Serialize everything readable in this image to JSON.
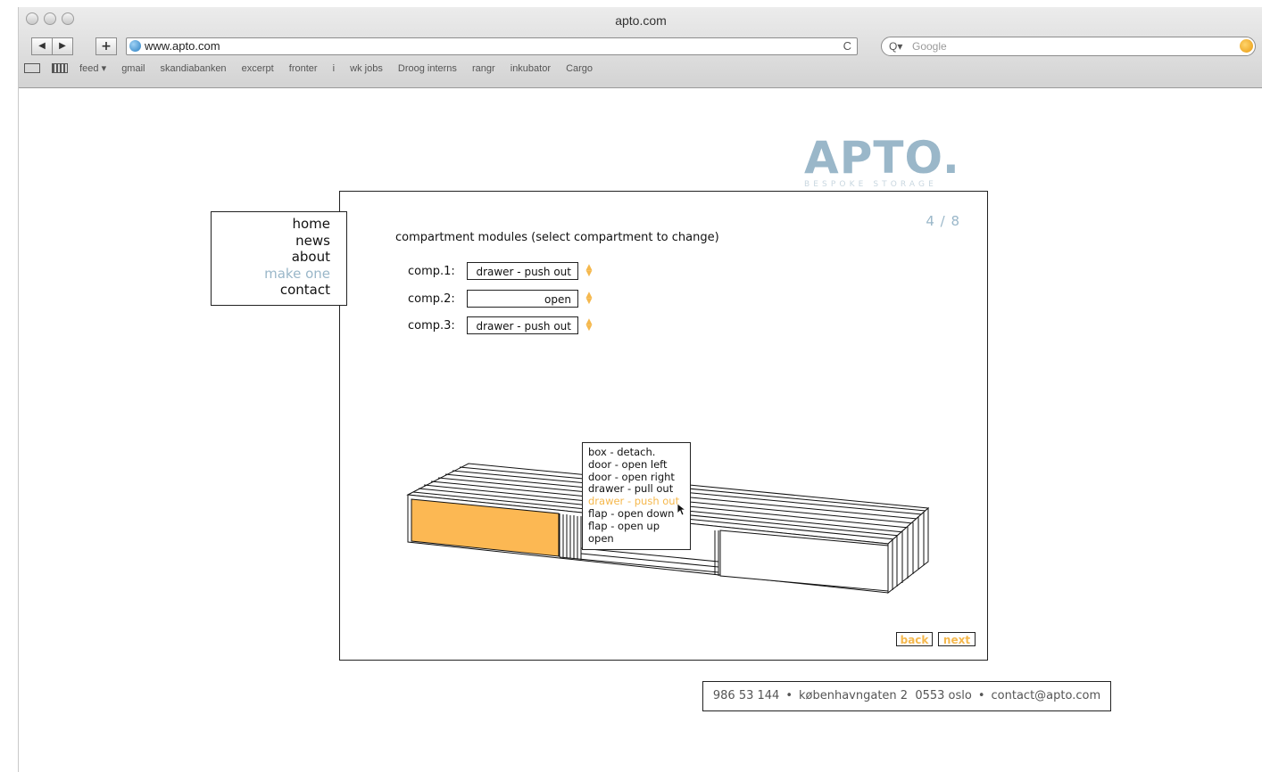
{
  "browser": {
    "window_title": "apto.com",
    "back_glyph": "◀",
    "forward_glyph": "▶",
    "add_glyph": "+",
    "url": "www.apto.com",
    "reload_glyph": "C",
    "search_prefix": "Q▾",
    "search_placeholder": "Google",
    "bookmarks": [
      "feed ▾",
      "gmail",
      "skandiabanken",
      "excerpt",
      "fronter",
      "i",
      "wk jobs",
      "Droog interns",
      "rangr",
      "inkubator",
      "Cargo"
    ]
  },
  "site": {
    "logo": "APTO.",
    "tagline": "BESPOKE STORAGE",
    "nav": [
      "home",
      "news",
      "about",
      "make one",
      "contact"
    ],
    "active_nav": "make one"
  },
  "configurator": {
    "counter": "4 / 8",
    "heading": "compartment modules (select compartment to change)",
    "compartments": [
      {
        "label": "comp.1:",
        "value": "drawer - push out"
      },
      {
        "label": "comp.2:",
        "value": "open"
      },
      {
        "label": "comp.3:",
        "value": "drawer - push out"
      }
    ],
    "dropdown_options": [
      "box - detach.",
      "door - open left",
      "door - open right",
      "drawer - pull out",
      "drawer - push out",
      "flap - open down",
      "flap - open up",
      "open"
    ],
    "highlighted_option": "drawer - push out",
    "back_label": "back",
    "next_label": "next"
  },
  "footer": {
    "phone": "986 53 144",
    "address": "københavngaten 2  0553 oslo",
    "email": "contact@apto.com",
    "separator": "•"
  },
  "colors": {
    "accent_orange": "#f5b84d",
    "brand_blue": "#9ab7c9"
  }
}
